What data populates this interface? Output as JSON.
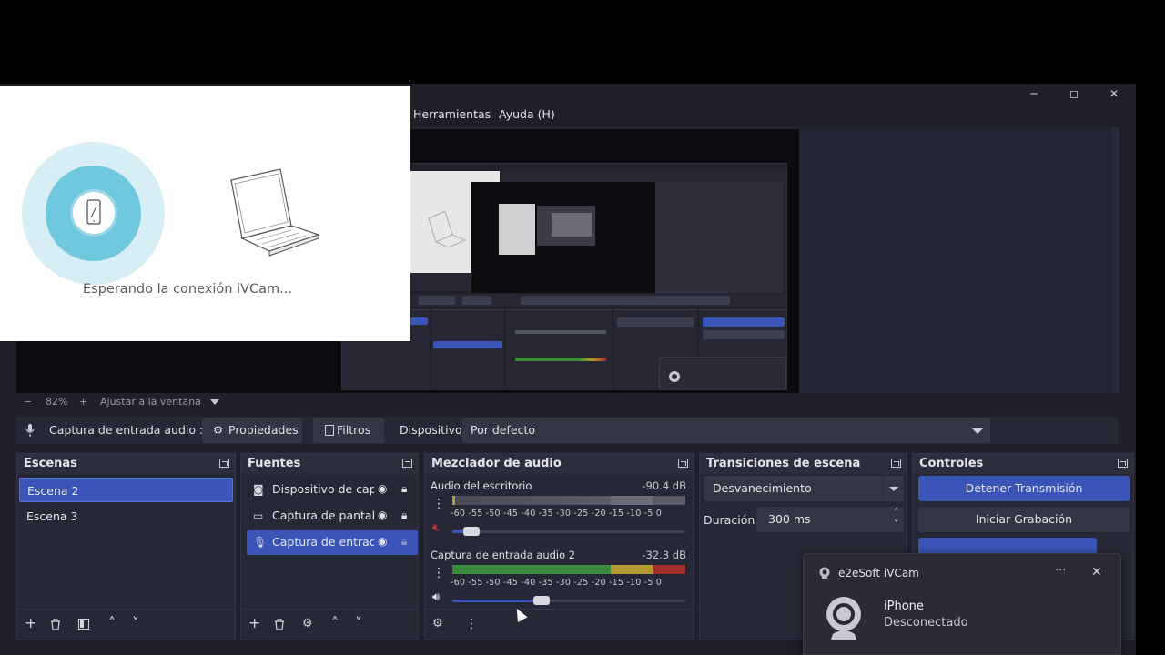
{
  "window": {
    "menu": [
      "Herramientas",
      "Ayuda (H)"
    ],
    "controls": [
      "─",
      "◻",
      "✕"
    ]
  },
  "preview": {
    "zoom_minus": "−",
    "zoom_value": "82%",
    "zoom_plus": "+",
    "fit_label": "Ajustar a la ventana"
  },
  "source_bar": {
    "source_name": "Captura de entrada audio :",
    "properties_label": "Propiedades",
    "filters_label": "Filtros",
    "device_label": "Dispositivo",
    "device_value": "Por defecto"
  },
  "scenes": {
    "title": "Escenas",
    "items": [
      "Escena 2",
      "Escena 3"
    ]
  },
  "sources": {
    "title": "Fuentes",
    "items": [
      "Dispositivo de capt",
      "Captura de pantalli",
      "Captura de entrada"
    ]
  },
  "mixer": {
    "title": "Mezclador de audio",
    "scale": "-60 -55 -50 -45 -40 -35 -30 -25 -20 -15 -10  -5   0",
    "channels": [
      {
        "name": "Audio del escritorio",
        "db": "-90.4 dB",
        "level": 0.0,
        "volume": 0.06,
        "muted": true
      },
      {
        "name": "Captura de entrada audio 2",
        "db": "-32.3 dB",
        "level": 1.0,
        "volume": 0.36,
        "muted": false
      }
    ]
  },
  "transitions": {
    "title": "Transiciones de escena",
    "selected": "Desvanecimiento",
    "duration_label": "Duración",
    "duration_value": "300 ms"
  },
  "controls": {
    "title": "Controles",
    "stop_stream": "Detener Transmisión",
    "start_recording": "Iniciar Grabación"
  },
  "ivcam": {
    "status": "Esperando la conexión iVCam..."
  },
  "notification": {
    "app": "e2eSoft iVCam",
    "title": "iPhone",
    "body": "Desconectado",
    "more": "···",
    "close": "✕"
  },
  "colors": {
    "accent": "#3a55b8",
    "panel": "#272835",
    "background": "#1f202a",
    "meter_green": "#3d8b3d",
    "meter_yellow": "#b59a32",
    "meter_red": "#a72d2d"
  }
}
